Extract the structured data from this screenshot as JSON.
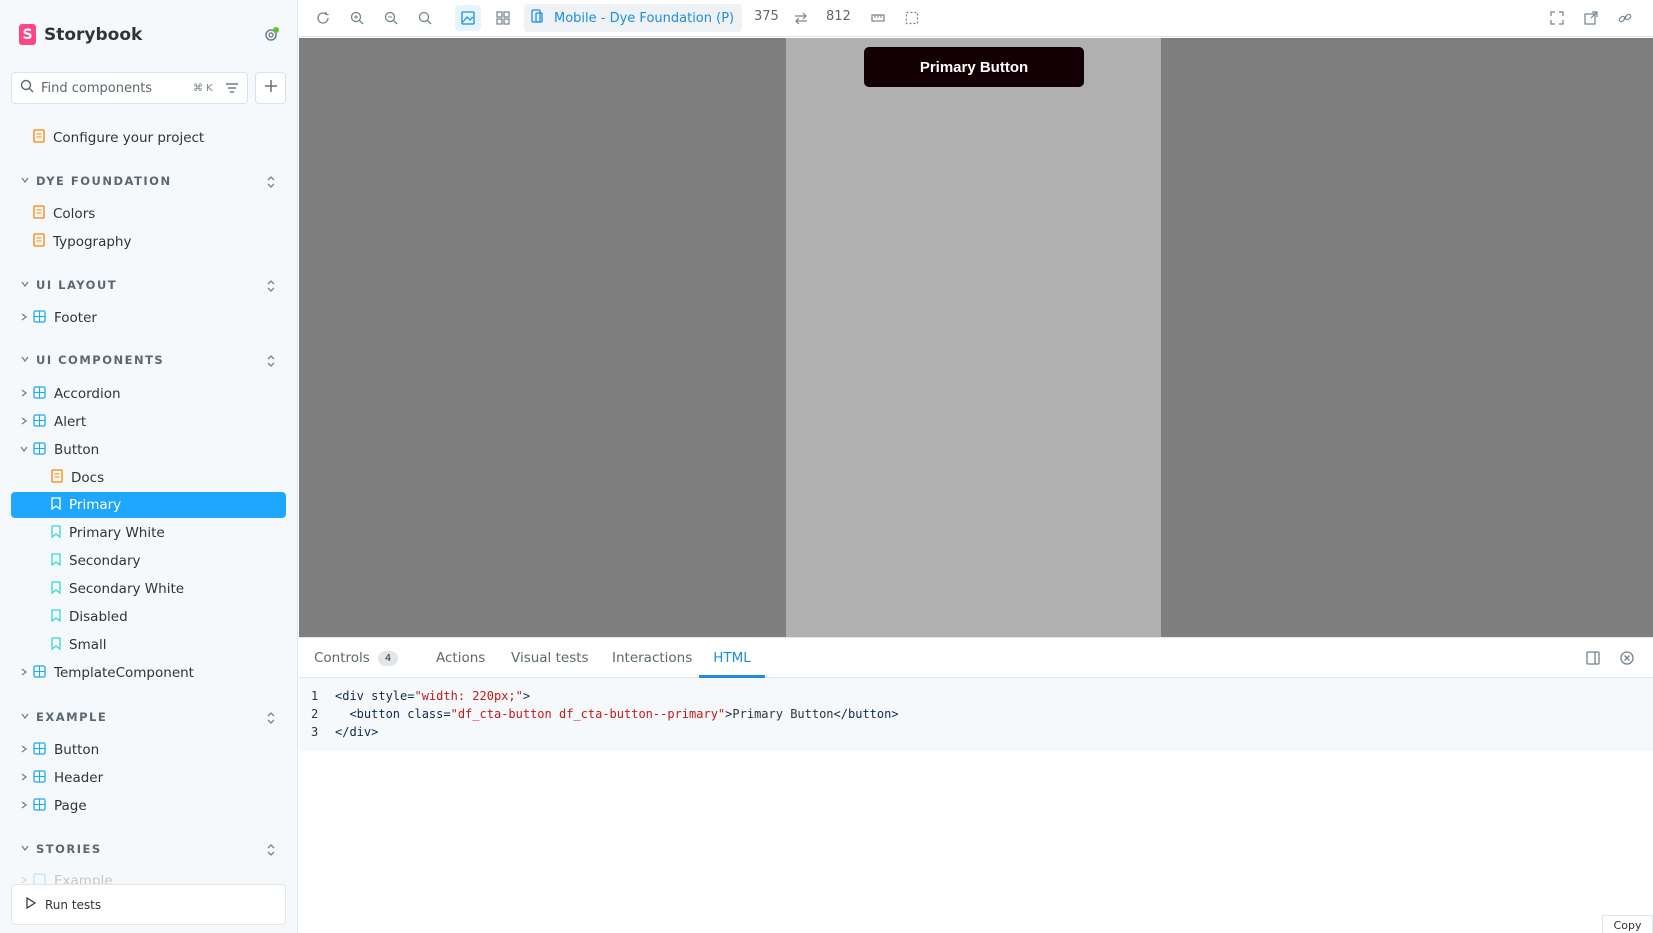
{
  "brand": {
    "name": "Storybook",
    "logo_letter": "S",
    "accent": "#ff4785"
  },
  "search": {
    "placeholder": "Find components",
    "shortcut": "⌘ K"
  },
  "sidebar": {
    "top_items": [
      {
        "label": "Configure your project",
        "icon": "document-icon"
      }
    ],
    "sections": [
      {
        "title": "DYE FOUNDATION",
        "items": [
          "Colors",
          "Typography"
        ]
      },
      {
        "title": "UI LAYOUT",
        "items": [
          "Footer"
        ]
      },
      {
        "title": "UI COMPONENTS",
        "items": [
          "Accordion",
          "Alert",
          "Button",
          "TemplateComponent"
        ],
        "button_children": [
          "Docs",
          "Primary",
          "Primary White",
          "Secondary",
          "Secondary White",
          "Disabled",
          "Small"
        ],
        "selected": "Primary"
      },
      {
        "title": "EXAMPLE",
        "items": [
          "Button",
          "Header",
          "Page"
        ]
      },
      {
        "title": "STORIES",
        "items": [
          "Example"
        ]
      }
    ],
    "run_tests_label": "Run tests"
  },
  "toolbar": {
    "viewport_name": "Mobile - Dye Foundation (P)",
    "width": "375",
    "height": "812"
  },
  "preview": {
    "button_label": "Primary Button",
    "button_color": "#130005"
  },
  "addons": {
    "tabs": [
      "Controls",
      "Actions",
      "Visual tests",
      "Interactions",
      "HTML"
    ],
    "controls_count": "4",
    "active_tab": "HTML",
    "code_lines": [
      {
        "n": "1",
        "parts": [
          [
            "tag",
            "<div "
          ],
          [
            "attr",
            "style="
          ],
          [
            "str",
            "\"width: 220px;\""
          ],
          [
            "tag",
            ">"
          ]
        ]
      },
      {
        "n": "2",
        "parts": [
          [
            "tag",
            "  <button "
          ],
          [
            "attr",
            "class="
          ],
          [
            "str",
            "\"df_cta-button df_cta-button--primary\""
          ],
          [
            "tag",
            ">"
          ],
          [
            "txt",
            "Primary Button"
          ],
          [
            "tag",
            "</button>"
          ]
        ]
      },
      {
        "n": "3",
        "parts": [
          [
            "tag",
            "</div>"
          ]
        ]
      }
    ],
    "copy_label": "Copy"
  },
  "colors": {
    "selection": "#1ea7fd",
    "link": "#1e8ee0",
    "story_icon": "#37d5d3",
    "component_icon": "#1ea7fd",
    "doc_icon": "#ff8300"
  }
}
